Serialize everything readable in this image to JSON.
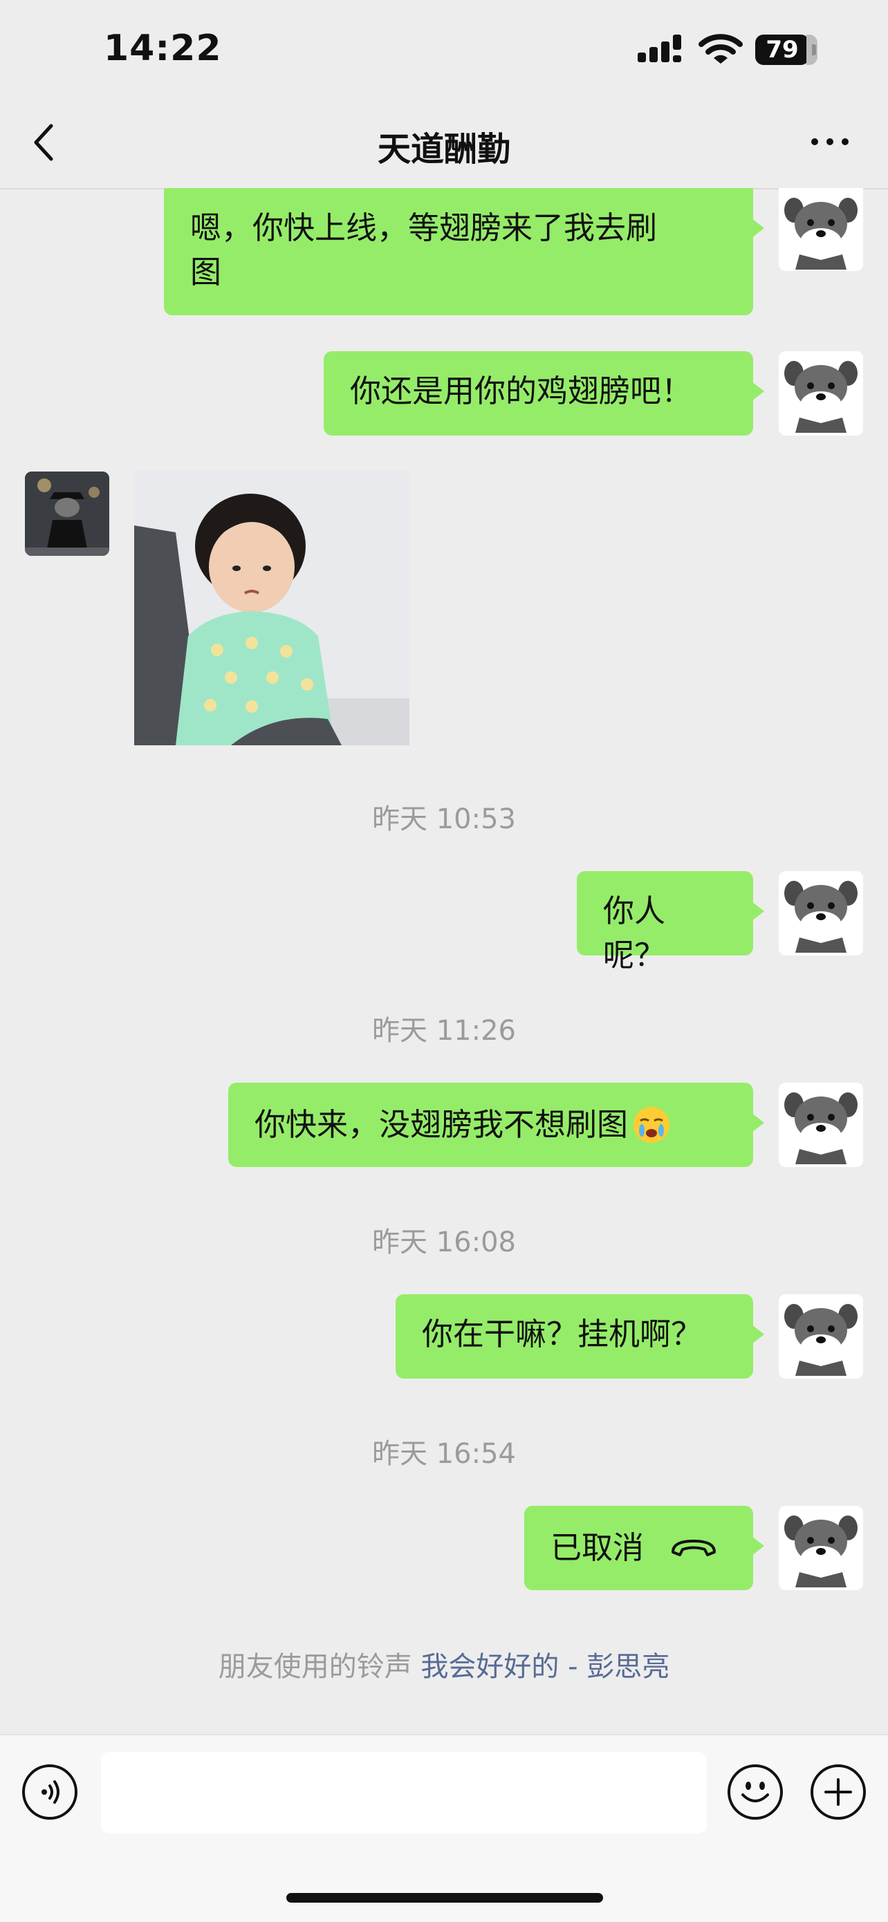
{
  "status_bar": {
    "time": "14:22",
    "battery": "79"
  },
  "nav": {
    "title": "天道酬勤"
  },
  "messages": [
    {
      "text_line1": "嗯，你快上线，等翅膀来了我去刷",
      "text_line2": "图"
    },
    {
      "text": "你还是用你的鸡翅膀吧！"
    },
    {
      "text": "你人呢？"
    },
    {
      "text": "你快来，没翅膀我不想刷图"
    },
    {
      "text": "你在干嘛？挂机啊？"
    },
    {
      "text": "已取消"
    }
  ],
  "timestamps": [
    "昨天 10:53",
    "昨天 11:26",
    "昨天 16:08",
    "昨天 16:54"
  ],
  "ringtone": {
    "prefix": "朋友使用的铃声",
    "song": "我会好好的 - 彭思亮"
  },
  "colors": {
    "sent_bubble": "#95EC69",
    "background": "#EDEDED",
    "link": "#576B95"
  }
}
